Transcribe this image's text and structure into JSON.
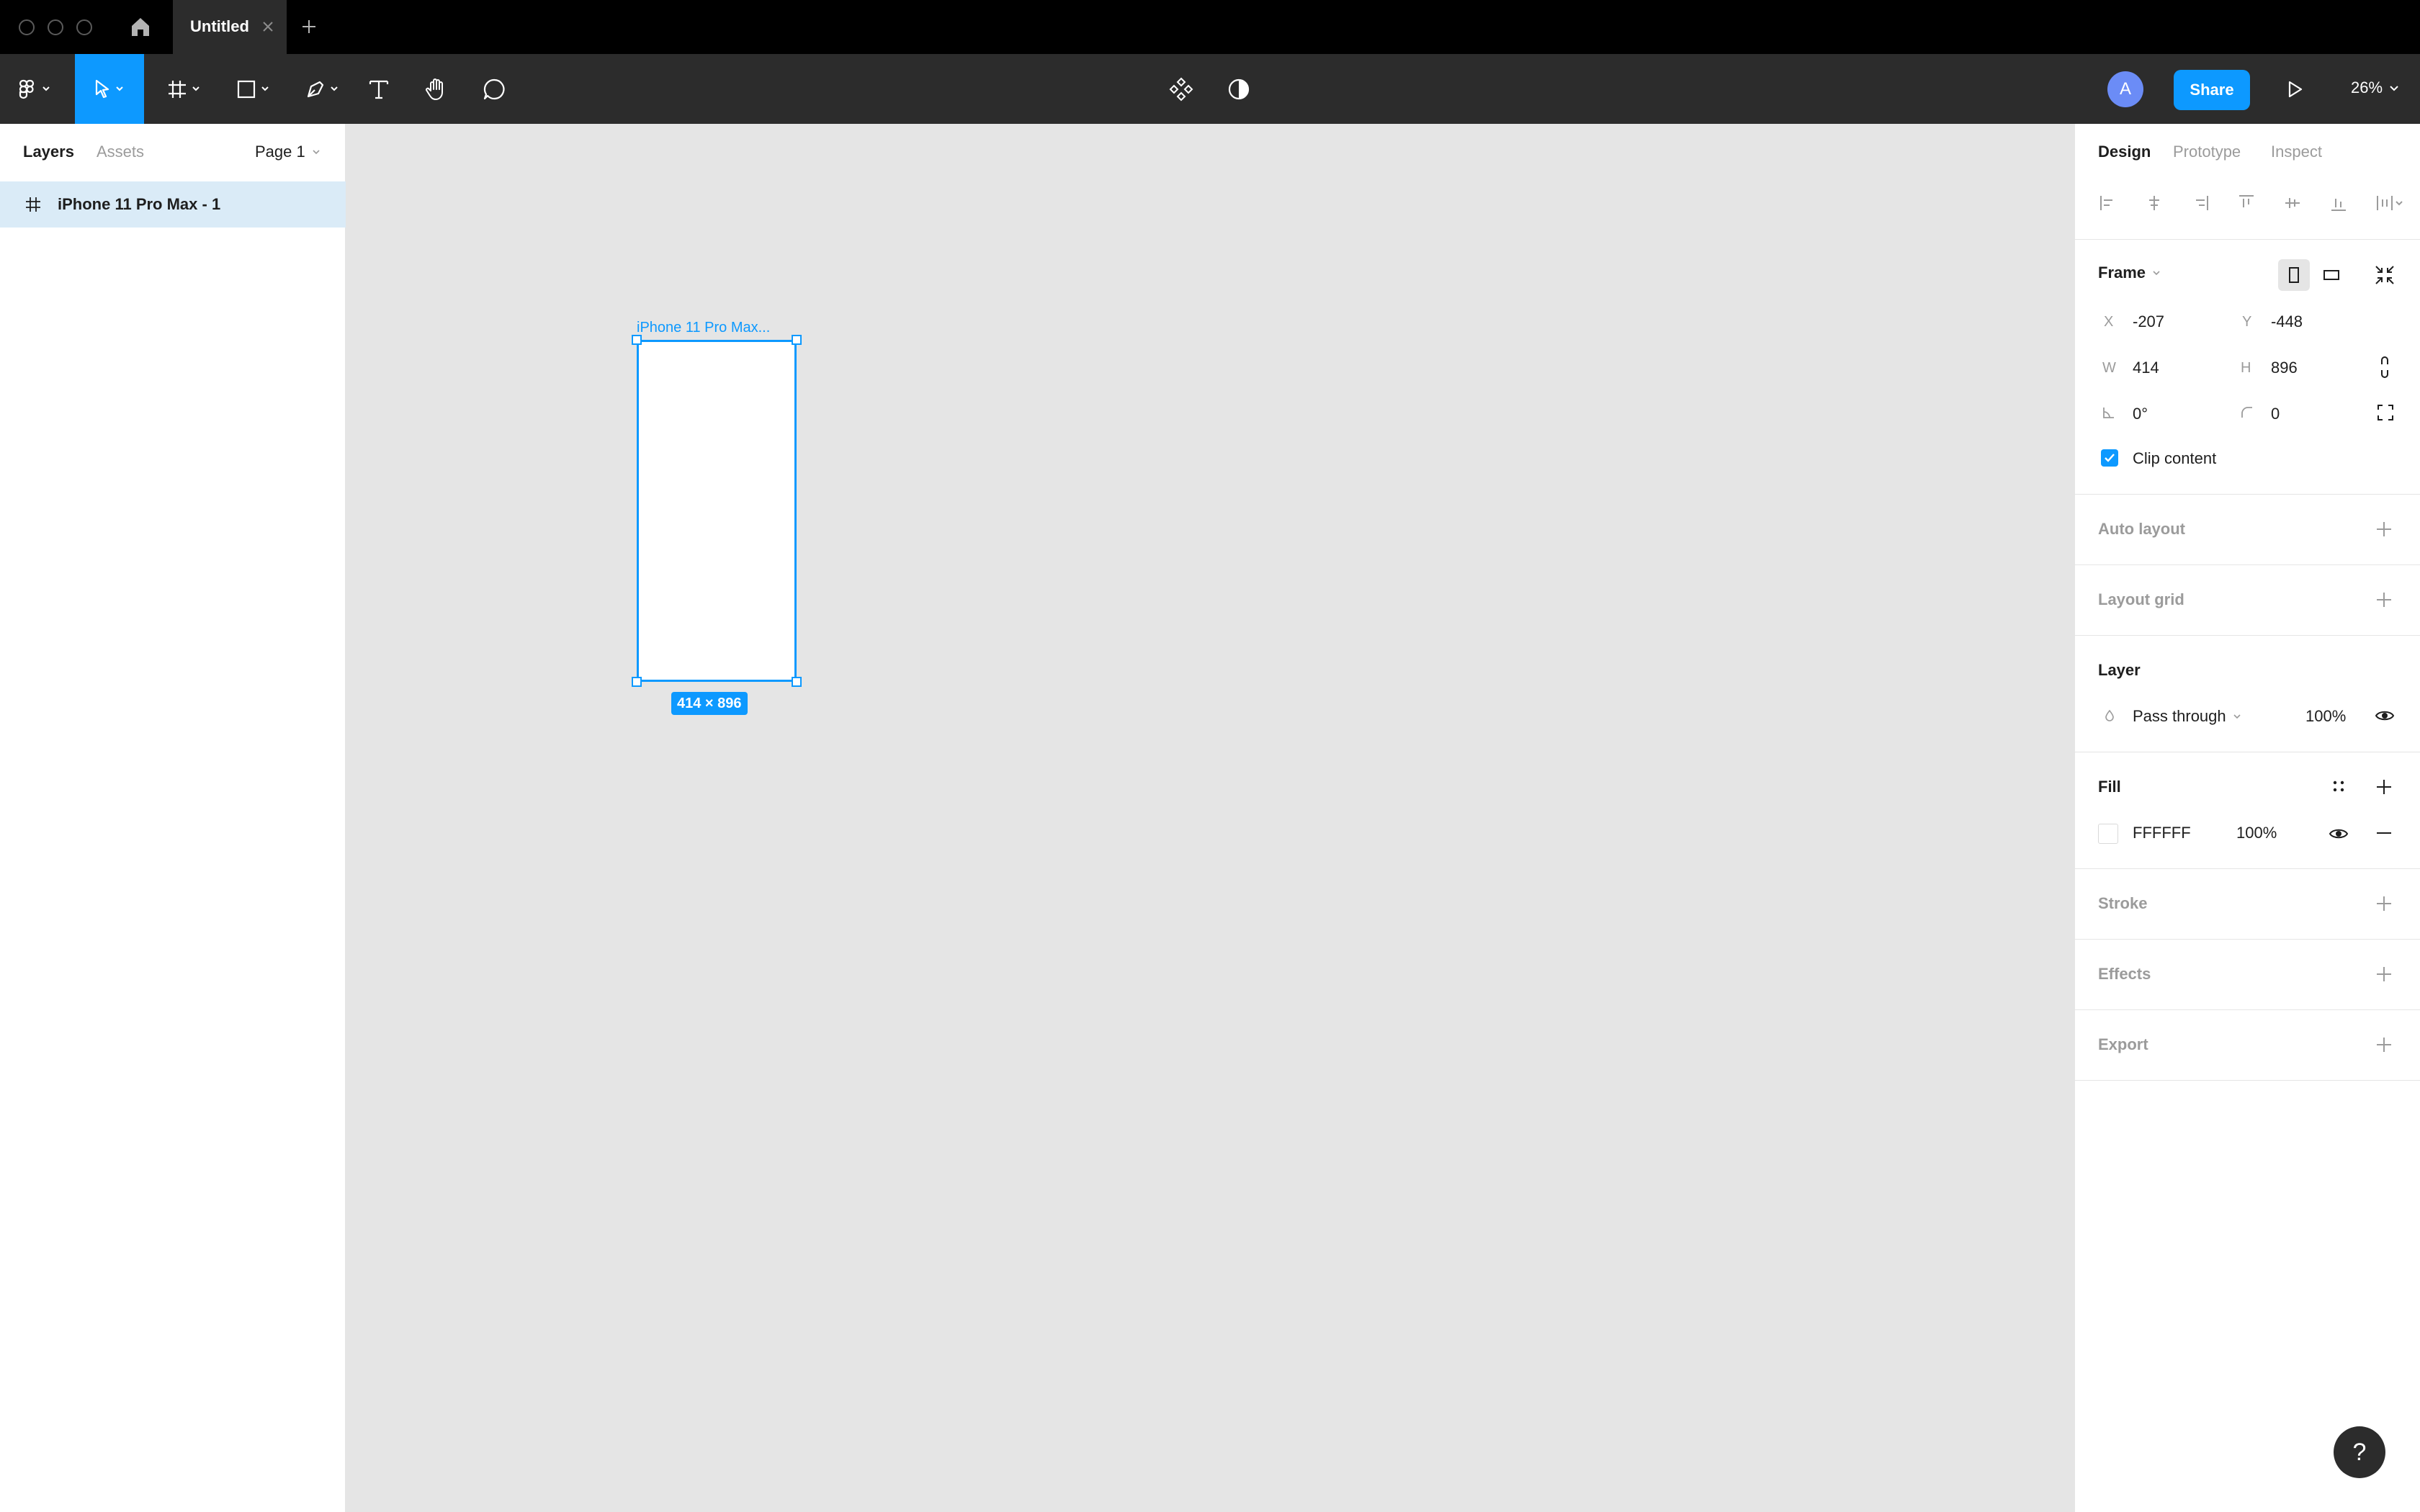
{
  "tabbar": {
    "doc_title": "Untitled",
    "home_icon": "home-icon",
    "close_icon": "close-icon",
    "new_tab_icon": "plus-icon"
  },
  "toolbar": {
    "tools": [
      "figma-menu",
      "move",
      "frame",
      "shape",
      "pen",
      "text",
      "hand",
      "comment"
    ],
    "active_tool": "move",
    "center_icons": [
      "components-icon",
      "contrast-icon"
    ],
    "avatar_initial": "A",
    "share_label": "Share",
    "zoom_label": "26%"
  },
  "left_panel": {
    "tabs": [
      "Layers",
      "Assets"
    ],
    "active_tab": "Layers",
    "page_label": "Page 1",
    "layers": [
      {
        "name": "iPhone 11 Pro Max - 1",
        "type": "frame",
        "selected": true
      }
    ]
  },
  "canvas": {
    "frame_label": "iPhone 11 Pro Max...",
    "size_badge": "414 × 896",
    "background": "#e5e5e5"
  },
  "right_panel": {
    "tabs": [
      "Design",
      "Prototype",
      "Inspect"
    ],
    "active_tab": "Design",
    "frame": {
      "title": "Frame",
      "x_label": "X",
      "x": "-207",
      "y_label": "Y",
      "y": "-448",
      "w_label": "W",
      "w": "414",
      "h_label": "H",
      "h": "896",
      "rotation": "0°",
      "radius": "0",
      "clip_label": "Clip content",
      "clip_checked": true
    },
    "auto_layout": "Auto layout",
    "layout_grid": "Layout grid",
    "layer": {
      "title": "Layer",
      "blend": "Pass through",
      "opacity": "100%"
    },
    "fill": {
      "title": "Fill",
      "hex": "FFFFFF",
      "opacity": "100%"
    },
    "stroke": "Stroke",
    "effects": "Effects",
    "export": "Export"
  },
  "help_label": "?",
  "colors": {
    "accent": "#0d99ff",
    "toolbar": "#2c2c2c",
    "tabbar": "#000000",
    "selection_row": "#daebf7"
  }
}
